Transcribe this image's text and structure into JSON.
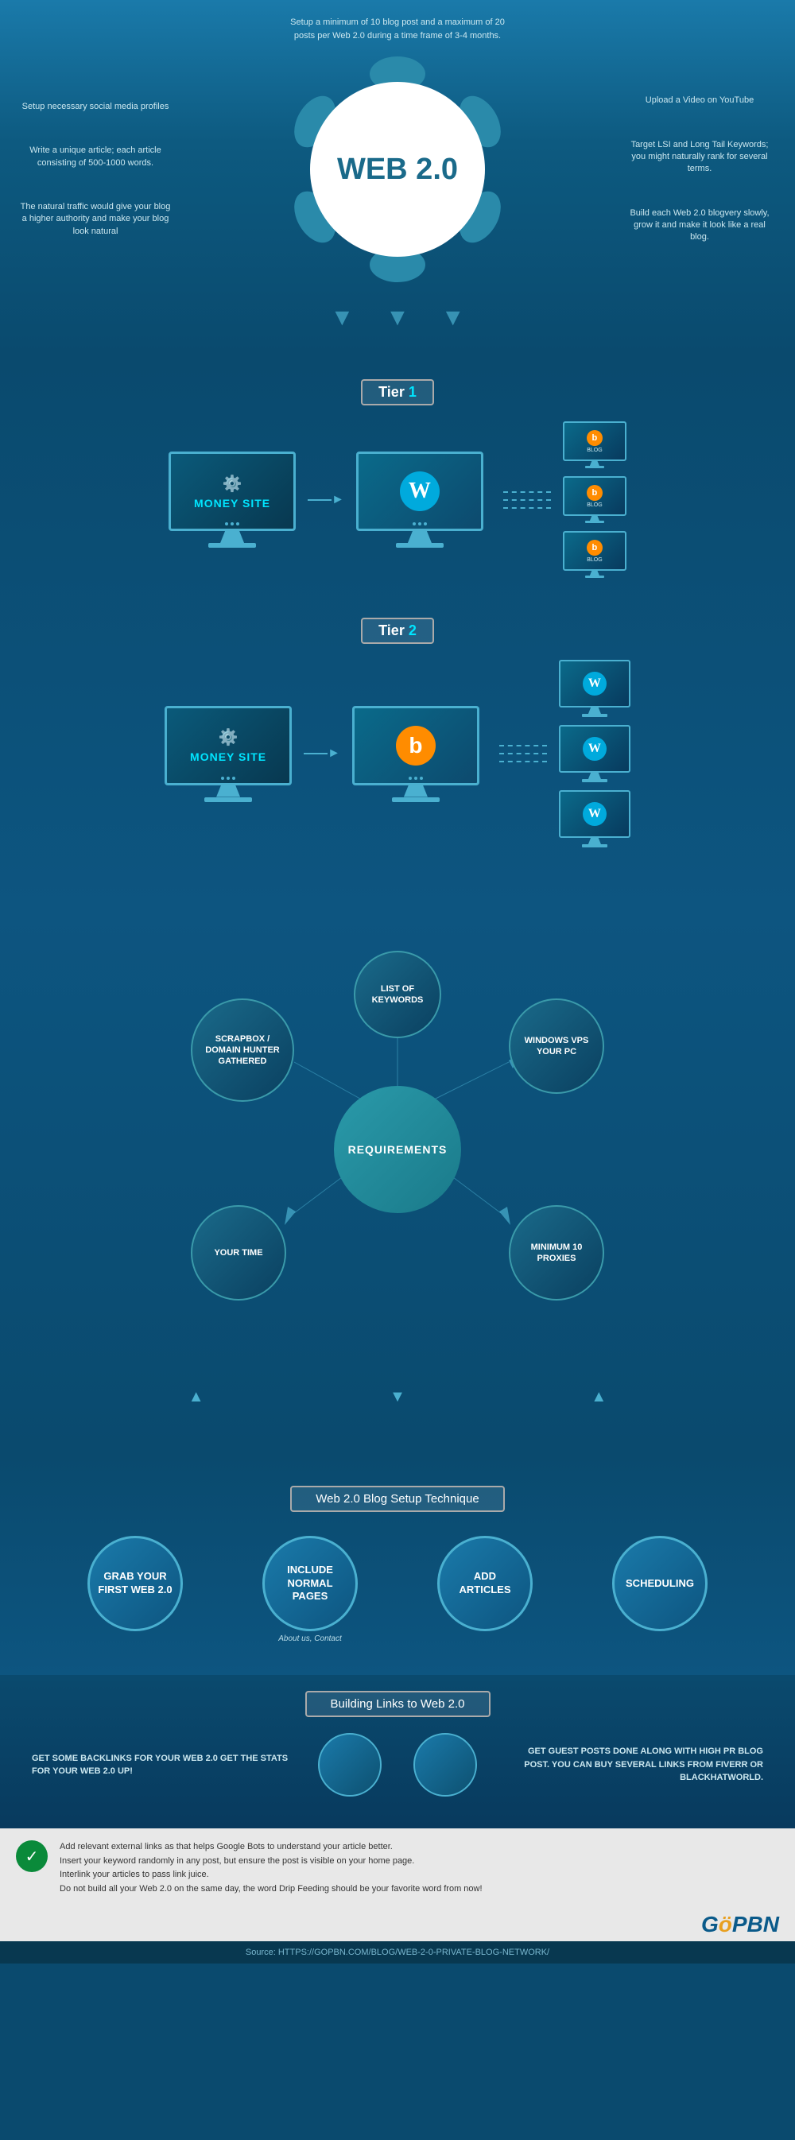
{
  "web20": {
    "title": "WEB 2.0",
    "center_tip": "Setup a minimum of 10 blog post and a maximum of 20 posts per Web 2.0 during a time frame of 3-4 months.",
    "tip_top_left": "Setup necessary social media profiles",
    "tip_top_right": "Upload a Video on YouTube",
    "tip_mid_left": "Write a unique article; each article consisting of 500-1000 words.",
    "tip_mid_right": "Target LSI and Long Tail Keywords; you might naturally rank for several terms.",
    "tip_bot_left": "The natural traffic would give your blog a higher authority and make your blog look natural",
    "tip_bot_right": "Build each Web 2.0 blogvery slowly, grow it and make it look like a real blog."
  },
  "tiers": {
    "tier1": {
      "label": "Tier ",
      "num": "1"
    },
    "tier2": {
      "label": "Tier ",
      "num": "2"
    },
    "money_site": "MONEY SITE"
  },
  "requirements": {
    "center": "REQUIREMENTS",
    "nodes": [
      "LIST OF KEYWORDS",
      "WINDOWS VPS YOUR PC",
      "MINIMUM 10 PROXIES",
      "YOUR TIME",
      "SCRAPBOX / DOMAIN HUNTER GATHERED"
    ]
  },
  "blog_setup": {
    "section_title": "Web 2.0 Blog Setup Technique",
    "steps": [
      {
        "label": "GRAB YOUR FIRST WEB 2.0",
        "sub": ""
      },
      {
        "label": "INCLUDE NORMAL PAGES",
        "sub": "About us, Contact"
      },
      {
        "label": "ADD ARTICLES",
        "sub": ""
      },
      {
        "label": "SCHEDULING",
        "sub": ""
      }
    ]
  },
  "building_links": {
    "section_title": "Building Links to Web 2.0",
    "left_text": "GET SOME BACKLINKS FOR YOUR WEB 2.0 GET THE STATS FOR YOUR WEB 2.0 UP!",
    "right_text": "GET GUEST POSTS DONE ALONG WITH HIGH PR BLOG POST. YOU CAN BUY SEVERAL LINKS FROM FIVERR OR BLACKHATWORLD."
  },
  "footer": {
    "note1": "Add relevant external links as that helps Google Bots to understand your article better.",
    "note2": "Insert your keyword randomly in any post, but ensure the post is visible on your home page.",
    "note3": "Interlink your articles to pass link juice.",
    "note4": "Do not build all your Web 2.0 on the same day, the word Drip Feeding should be your favorite word from now!",
    "logo": "GöPBN",
    "source": "Source: HTTPS://GOPBN.COM/BLOG/WEB-2-0-PRIVATE-BLOG-NETWORK/"
  }
}
